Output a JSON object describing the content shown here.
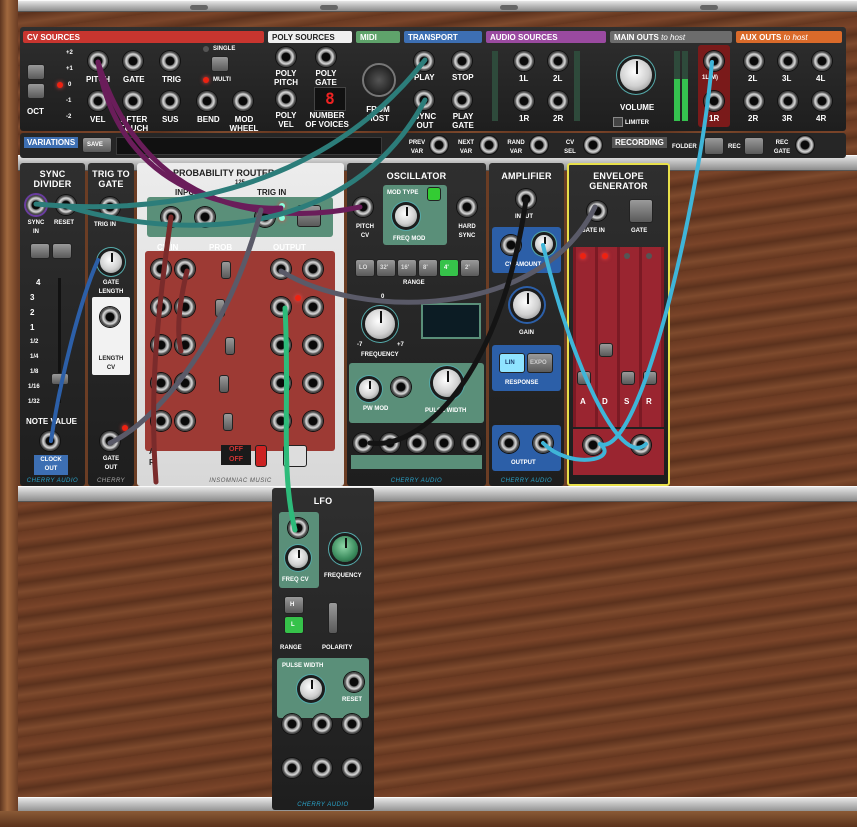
{
  "top_panel": {
    "cv_sources": {
      "title": "CV SOURCES",
      "octave_values": [
        "+2",
        "+1",
        "0",
        "-1",
        "-2"
      ],
      "oct_label": "OCT",
      "jacks": [
        "PITCH",
        "GATE",
        "TRIG",
        "VEL",
        "AFTER TOUCH",
        "SUS",
        "BEND",
        "MOD WHEEL"
      ],
      "single": "SINGLE",
      "multi": "MULTI"
    },
    "poly_sources": {
      "title": "POLY SOURCES",
      "jacks": [
        "POLY PITCH",
        "POLY GATE",
        "POLY VEL"
      ],
      "voices_label": "NUMBER OF VOICES",
      "voices_value": "8"
    },
    "midi": {
      "title": "MIDI",
      "label": "FROM HOST"
    },
    "transport": {
      "title": "TRANSPORT",
      "jacks": [
        "PLAY",
        "STOP",
        "SYNC OUT",
        "PLAY GATE"
      ]
    },
    "audio_sources": {
      "title": "AUDIO SOURCES",
      "jacks": [
        "1L",
        "2L",
        "1R",
        "2R"
      ]
    },
    "main_outs": {
      "title": "MAIN OUTS",
      "sub": "to host",
      "volume": "VOLUME",
      "limiter": "LIMITER",
      "jacks": [
        "1L(M)",
        "1R"
      ]
    },
    "aux_outs": {
      "title": "AUX OUTS",
      "sub": "to host",
      "jacks": [
        "2L",
        "3L",
        "4L",
        "2R",
        "3R",
        "4R"
      ]
    }
  },
  "variations_bar": {
    "title": "VARIATIONS",
    "save": "SAVE",
    "controls": [
      "PREV VAR",
      "NEXT VAR",
      "RAND VAR",
      "CV SEL"
    ],
    "recording": "RECORDING",
    "folder": "FOLDER",
    "rec": "REC",
    "rec_gate": "REC GATE"
  },
  "modules": {
    "sync_divider": {
      "title": "SYNC DIVIDER",
      "sync_in": "SYNC IN",
      "reset": "RESET",
      "values": [
        "4",
        "3",
        "2",
        "1",
        "1/2",
        "1/4",
        "1/8",
        "1/16",
        "1/32"
      ],
      "note_value": "NOTE VALUE",
      "clock_out": "CLOCK OUT",
      "brand": "CHERRY AUDIO"
    },
    "trig_to_gate": {
      "title": "TRIG TO GATE",
      "trig_in": "TRIG IN",
      "gate_length": "GATE LENGTH",
      "length_cv": "LENGTH CV",
      "gate_out": "GATE OUT",
      "brand": "CHERRY"
    },
    "probability_router": {
      "title": "PROBABILITY ROUTER",
      "version": "125",
      "input": "INPUT",
      "trig_in": "TRIG IN",
      "cv_in": "CV IN",
      "prob": "PROB",
      "output": "OUTPUT",
      "a": "A",
      "r": "R",
      "off1": "OFF",
      "off2": "OFF",
      "brand": "INSOMNIAC MUSIC"
    },
    "oscillator": {
      "title": "OSCILLATOR",
      "mod_type": "MOD TYPE",
      "pitch_cv": "PITCH CV",
      "freq_mod": "FREQ MOD",
      "hard_sync": "HARD SYNC",
      "ranges": [
        "LO",
        "32'",
        "16'",
        "8'",
        "4'",
        "2'"
      ],
      "active_range": "4'",
      "range": "RANGE",
      "frequency": "FREQUENCY",
      "freq_min": "-7",
      "freq_max": "+7",
      "freq_zero": "0",
      "pw_mod": "PW MOD",
      "pulse_width": "PULSE WIDTH",
      "brand": "CHERRY AUDIO"
    },
    "amplifier": {
      "title": "AMPLIFIER",
      "input": "INPUT",
      "cv_amount": "CV AMOUNT",
      "gain": "GAIN",
      "lin": "LIN",
      "expo": "EXPO",
      "response": "RESPONSE",
      "output": "OUTPUT",
      "brand": "CHERRY AUDIO"
    },
    "envelope": {
      "title": "ENVELOPE GENERATOR",
      "gate_in": "GATE IN",
      "gate": "GATE",
      "sliders": [
        "A",
        "D",
        "S",
        "R"
      ]
    },
    "lfo": {
      "title": "LFO",
      "freq_cv": "FREQ CV",
      "frequency": "FREQUENCY",
      "h": "H",
      "l": "L",
      "range": "RANGE",
      "polarity": "POLARITY",
      "pulse_width": "PULSE WIDTH",
      "reset": "RESET",
      "brand": "CHERRY AUDIO"
    }
  },
  "colors": {
    "cv": "#c8352f",
    "poly": "#ffffff",
    "midi": "#5fa36b",
    "transport": "#3d6fb3",
    "audio": "#9a4aa0",
    "main": "#6c6c6c",
    "aux": "#d96a2a",
    "cable_purple": "#6a1d5a",
    "cable_teal": "#2c7d7a",
    "cable_grey": "#5a5a68",
    "cable_brown": "#7a2b2b",
    "cable_green": "#2dbb7a",
    "cable_lightblue": "#3fb5d8",
    "cable_black": "#141414"
  }
}
